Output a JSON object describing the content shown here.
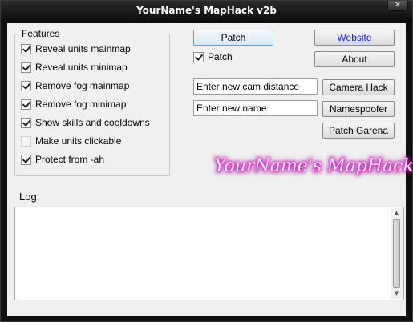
{
  "window": {
    "title": "YourName's MapHack v2b",
    "close_glyph": "✕"
  },
  "features": {
    "legend": "Features",
    "items": [
      {
        "label": "Reveal units mainmap",
        "checked": true,
        "enabled": true
      },
      {
        "label": "Reveal units minimap",
        "checked": true,
        "enabled": true
      },
      {
        "label": "Remove fog mainmap",
        "checked": true,
        "enabled": true
      },
      {
        "label": "Remove fog minimap",
        "checked": true,
        "enabled": true
      },
      {
        "label": "Show skills and cooldowns",
        "checked": true,
        "enabled": true
      },
      {
        "label": "Make units clickable",
        "checked": false,
        "enabled": false
      },
      {
        "label": "Protect from -ah",
        "checked": true,
        "enabled": true
      }
    ]
  },
  "patch": {
    "button_label": "Patch",
    "checkbox_label": "Patch",
    "checkbox_checked": true
  },
  "links": {
    "website_label": "Website",
    "about_label": "About"
  },
  "camera": {
    "input_value": "Enter new cam distance",
    "button_label": "Camera Hack"
  },
  "name": {
    "input_value": "Enter new name",
    "button_label": "Namespoofer"
  },
  "garena": {
    "button_label": "Patch Garena"
  },
  "logo_text": "YourName's MapHack",
  "log": {
    "label": "Log:",
    "content": "",
    "scroll_up_icon": "up-arrow-icon",
    "scroll_down_icon": "down-arrow-icon"
  }
}
